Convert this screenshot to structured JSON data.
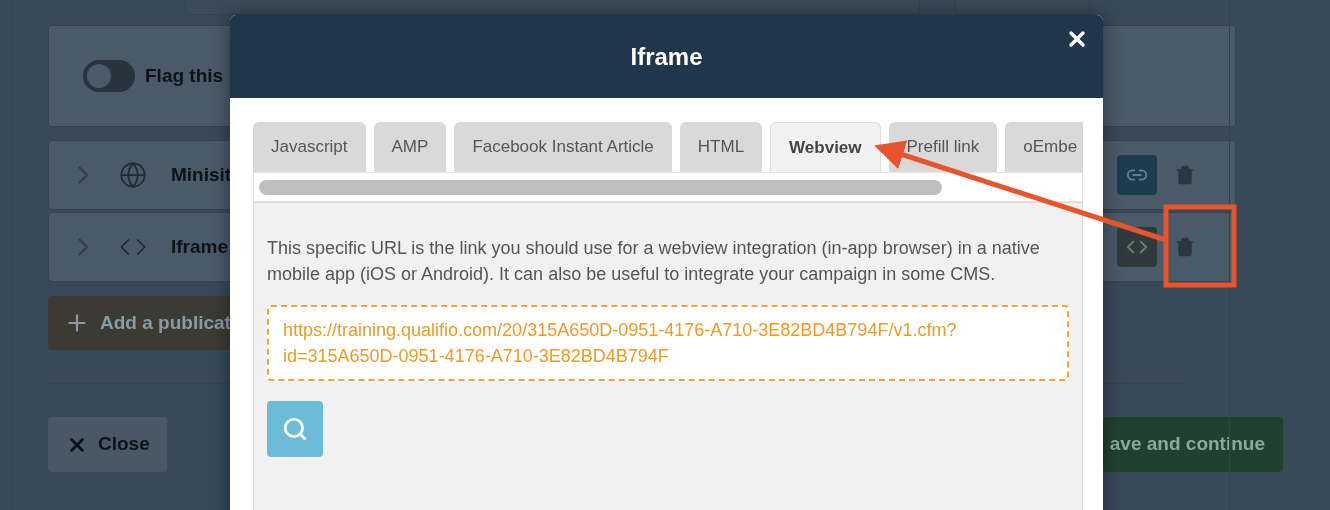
{
  "background": {
    "flag_toggle": {
      "label": "Flag this",
      "on": false
    },
    "publications": [
      {
        "kind": "globe",
        "title": "Minisit"
      },
      {
        "kind": "code",
        "title": "Iframe"
      }
    ],
    "add_button": "Add a publicat",
    "close_button": "Close",
    "save_button": "ave and continue"
  },
  "modal": {
    "title": "Iframe",
    "tabs": [
      {
        "label": "Javascript",
        "selected": false
      },
      {
        "label": "AMP",
        "selected": false
      },
      {
        "label": "Facebook Instant Article",
        "selected": false
      },
      {
        "label": "HTML",
        "selected": false
      },
      {
        "label": "Webview",
        "selected": true
      },
      {
        "label": "Prefill link",
        "selected": false
      },
      {
        "label": "oEmbe",
        "selected": false
      }
    ],
    "description": "This specific URL is the link you should use for a webview integration (in-app browser) in a native mobile app (iOS or Android). It can also be useful to integrate your campaign in some CMS.",
    "url": "https://training.qualifio.com/20/315A650D-0951-4176-A710-3E82BD4B794F/v1.cfm?id=315A650D-0951-4176-A710-3E82BD4B794F"
  }
}
